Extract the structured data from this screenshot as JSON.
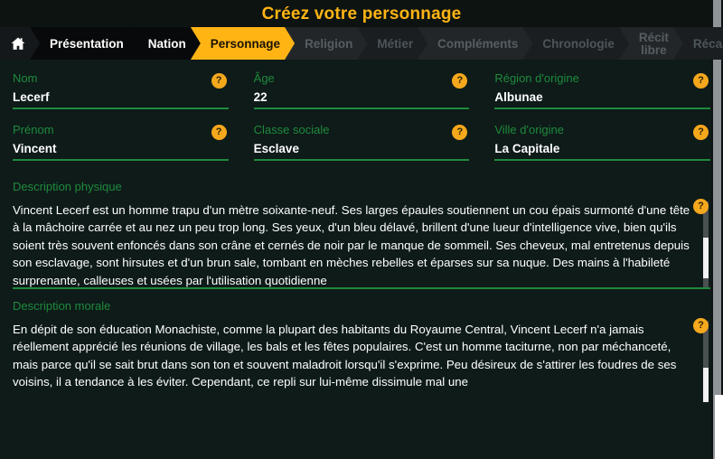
{
  "header": {
    "title": "Créez votre personnage"
  },
  "steps": [
    {
      "label": "",
      "icon": "home-icon",
      "state": "home",
      "name": "step-home"
    },
    {
      "label": "Présentation",
      "state": "done",
      "name": "step-presentation"
    },
    {
      "label": "Nation",
      "state": "done",
      "name": "step-nation"
    },
    {
      "label": "Personnage",
      "state": "current",
      "name": "step-personnage"
    },
    {
      "label": "Religion",
      "state": "todo",
      "name": "step-religion"
    },
    {
      "label": "Métier",
      "state": "todo-alt",
      "name": "step-metier"
    },
    {
      "label": "Compléments",
      "state": "todo",
      "name": "step-complements"
    },
    {
      "label": "Chronologie",
      "state": "todo-alt",
      "name": "step-chronologie"
    },
    {
      "label": "Récit\nlibre",
      "state": "todo",
      "name": "step-recit-libre"
    },
    {
      "label": "Récapitulatif",
      "state": "todo-alt",
      "name": "step-recapitulatif"
    }
  ],
  "fields": [
    {
      "label": "Nom",
      "value": "Lecerf",
      "name": "field-nom",
      "help": "?"
    },
    {
      "label": "Âge",
      "value": "22",
      "name": "field-age",
      "help": "?"
    },
    {
      "label": "Région d'origine",
      "value": "Albunae",
      "name": "field-region-origine",
      "help": "?"
    },
    {
      "label": "Prénom",
      "value": "Vincent",
      "name": "field-prenom",
      "help": "?"
    },
    {
      "label": "Classe sociale",
      "value": "Esclave",
      "name": "field-classe-sociale",
      "help": "?"
    },
    {
      "label": "Ville d'origine",
      "value": "La Capitale",
      "name": "field-ville-origine",
      "help": "?"
    }
  ],
  "blocks": {
    "physique": {
      "label": "Description physique",
      "help": "?",
      "text": "Vincent Lecerf est un homme trapu d'un mètre soixante-neuf. Ses larges épaules soutiennent un cou épais surmonté d'une tête à la mâchoire carrée et au nez un peu trop long. Ses yeux, d'un bleu délavé, brillent d'une lueur d'intelligence vive, bien qu'ils soient très souvent enfoncés dans son crâne et cernés de noir par le manque de sommeil. Ses cheveux, mal entretenus depuis son esclavage, sont hirsutes et d'un brun sale, tombant en mèches rebelles et éparses sur sa nuque. Des mains à l'habileté surprenante, calleuses et usées par l'utilisation quotidienne"
    },
    "morale": {
      "label": "Description morale",
      "help": "?",
      "text": "En dépit de son éducation Monachiste, comme la plupart des habitants du Royaume Central, Vincent Lecerf n'a jamais réellement apprécié les réunions de village, les bals et les fêtes populaires. C'est un homme taciturne, non par méchanceté, mais parce qu'il se sait brut dans son ton et souvent maladroit lorsqu'il s'exprime. Peu désireux de s'attirer les foudres de ses voisins, il a tendance à les éviter. Cependant, ce repli sur lui-même dissimule mal une"
    }
  },
  "colors": {
    "accent": "#ffb414",
    "help_badge": "#f5a81c",
    "field_green": "#1f8a3c",
    "background": "#0e1b19",
    "step_done_bg": "#08090a",
    "step_todo_bg": "#222629"
  }
}
